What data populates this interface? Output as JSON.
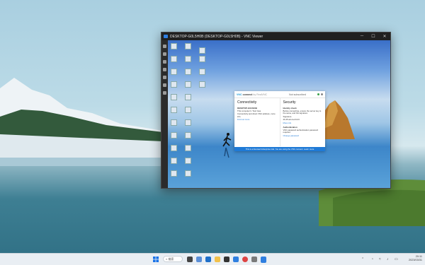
{
  "host_window": {
    "title": "DESKTOP-G0L5H0B (DESKTOP-G0L5H0B) - VNC Viewer",
    "controls": [
      "─",
      "☐",
      "✕"
    ]
  },
  "remote_desktop": {
    "vnc_app": {
      "logo_prefix": "VNC",
      "logo_name": "connect",
      "logo_suffix": "by RealVNC",
      "status": "Not subscribed",
      "connectivity": {
        "heading": "Connectivity",
        "item1_title": "DESKTOP-G0L5H0B",
        "item1_text": "This computer’s: Tsuri Gas",
        "item2_text": "Connectivity and direct VNC address, more info",
        "link": "Find out more"
      },
      "security": {
        "heading": "Security",
        "item1_title": "Identity check",
        "item1_text": "Before connecting, ensure the server key is the same, and the signature",
        "sig_label": "Signature",
        "sig_value": "4b-45-ad-ca-24-44",
        "item1_more": "More info",
        "item2_title": "Authentication",
        "item2_text": "VNC password authentication password required",
        "link": "Change password"
      },
      "footer": "This is a licensed Enterprise trial. You are using the VNC connect. Learn more"
    }
  },
  "taskbar": {
    "search_placeholder": "検索",
    "time": "20:11",
    "date": "2023/03/31"
  },
  "colors": {
    "accent": "#1f7ad6",
    "taskbar_bg": "#e9eef3"
  }
}
